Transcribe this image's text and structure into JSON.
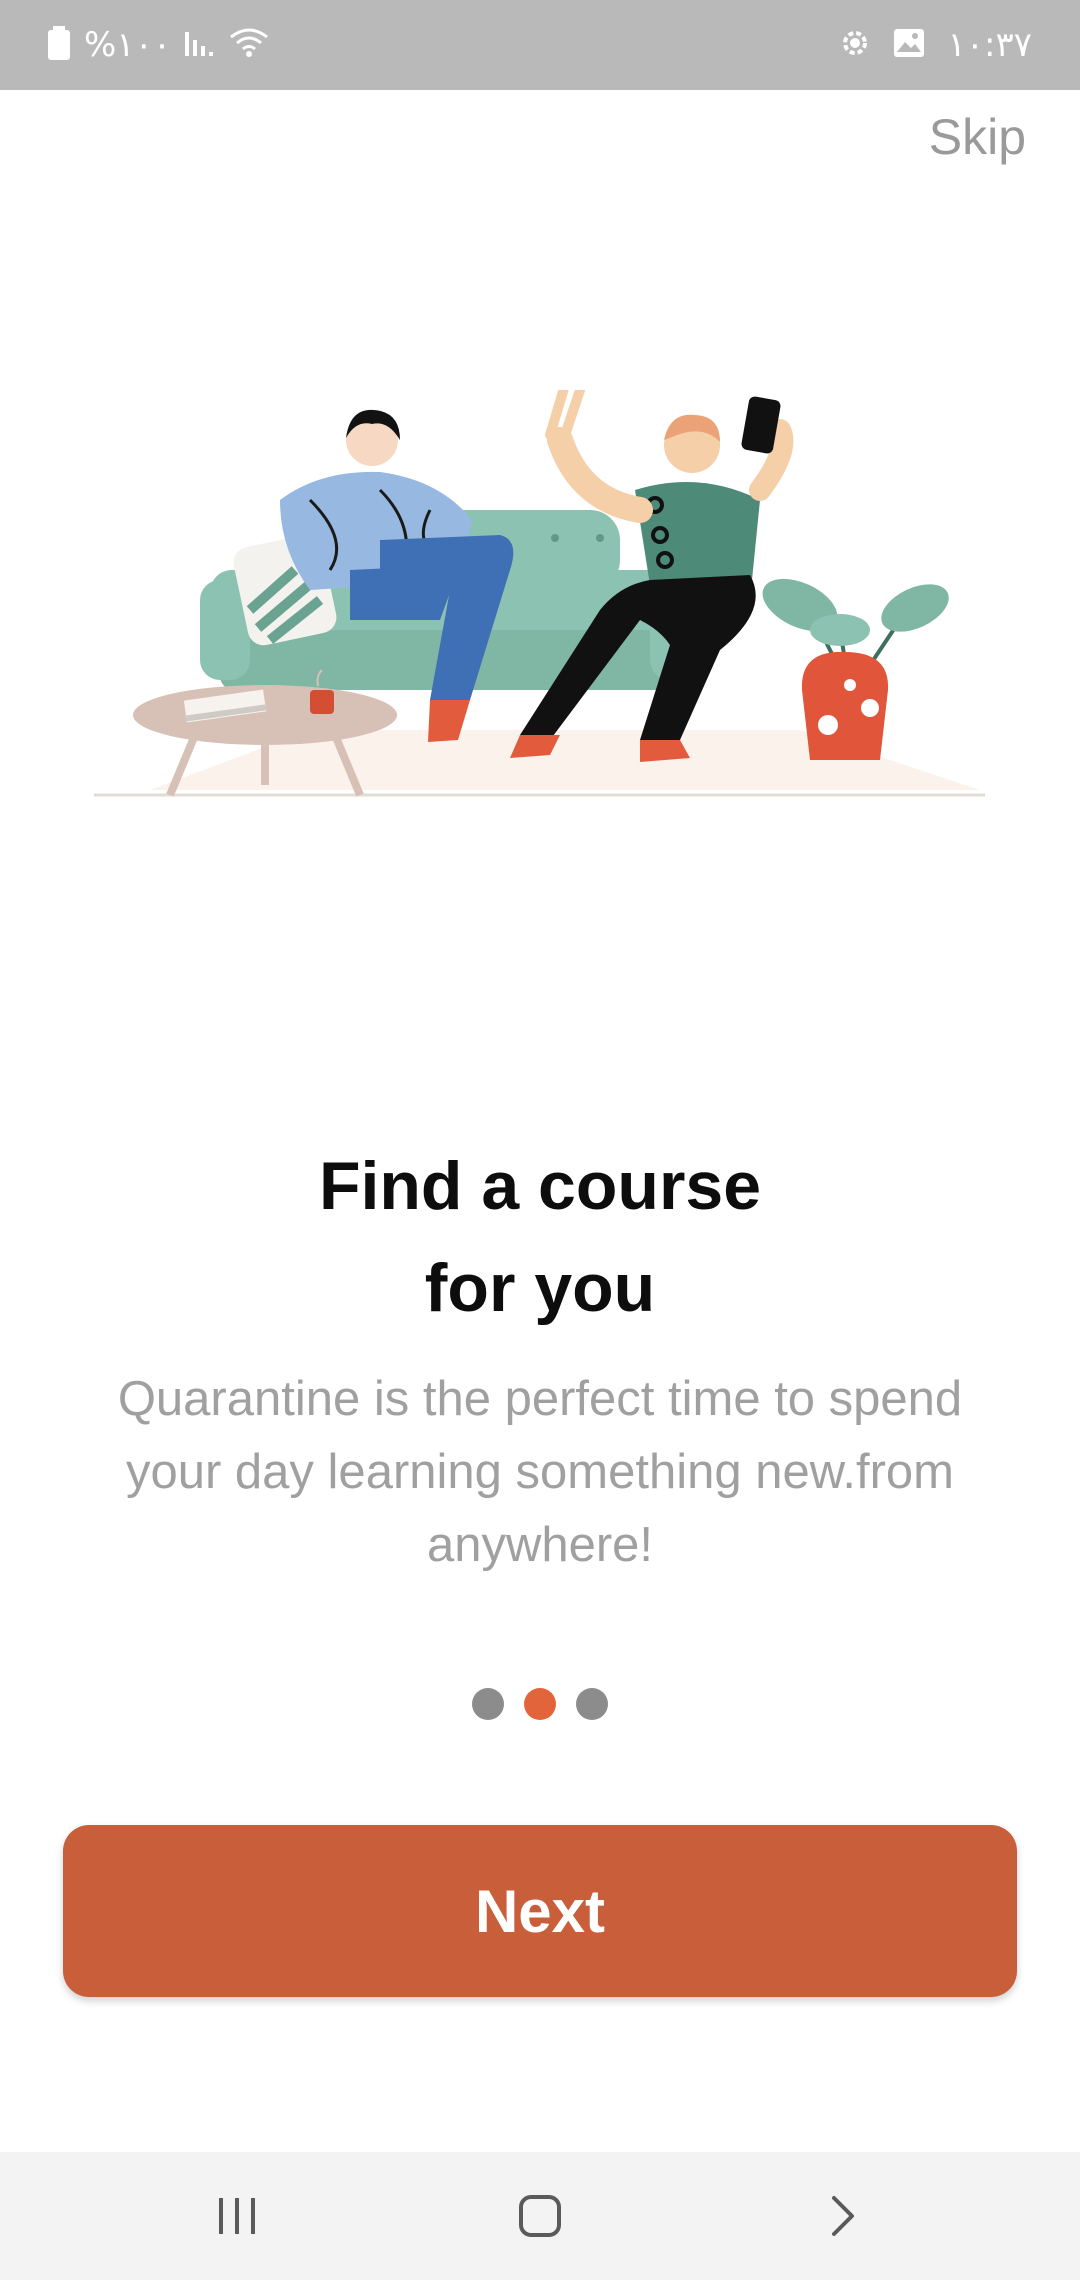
{
  "status_bar": {
    "battery_text": "%۱۰۰",
    "time": "۱۰:۳۷"
  },
  "onboarding": {
    "skip_label": "Skip",
    "title_line1": "Find a course",
    "title_line2": "for you",
    "description": "Quarantine is the perfect time to spend your day learning something new.from anywhere!",
    "current_page": 2,
    "total_pages": 3,
    "next_label": "Next"
  },
  "colors": {
    "accent": "#c95e3b",
    "active_dot": "#e2643a",
    "inactive_dot": "#8c8c8c",
    "muted_text": "#a0a0a0"
  },
  "nav_bar": {
    "icons": [
      "recents-icon",
      "home-icon",
      "back-icon"
    ]
  }
}
